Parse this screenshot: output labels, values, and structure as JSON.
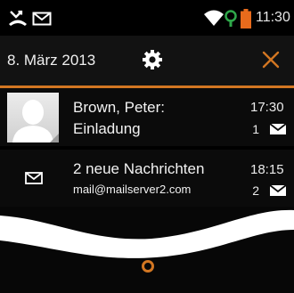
{
  "status_bar": {
    "clock": "11:30",
    "icons": [
      "missed-call-icon",
      "mail-icon",
      "wifi-icon",
      "sync-icon",
      "battery-icon"
    ]
  },
  "header": {
    "date": "8. März 2013",
    "settings_icon": "gear-icon",
    "close_icon": "close-icon"
  },
  "notifications": [
    {
      "line1": "Brown, Peter:",
      "line2": "Einladung",
      "time": "17:30",
      "count": "1",
      "icon": "envelope-icon"
    },
    {
      "line1": "2 neue Nachrichten",
      "line2": "mail@mailserver2.com",
      "time": "18:15",
      "count": "2",
      "icon": "envelope-icon"
    }
  ],
  "colors": {
    "accent": "#d27622",
    "background": "#070707"
  }
}
